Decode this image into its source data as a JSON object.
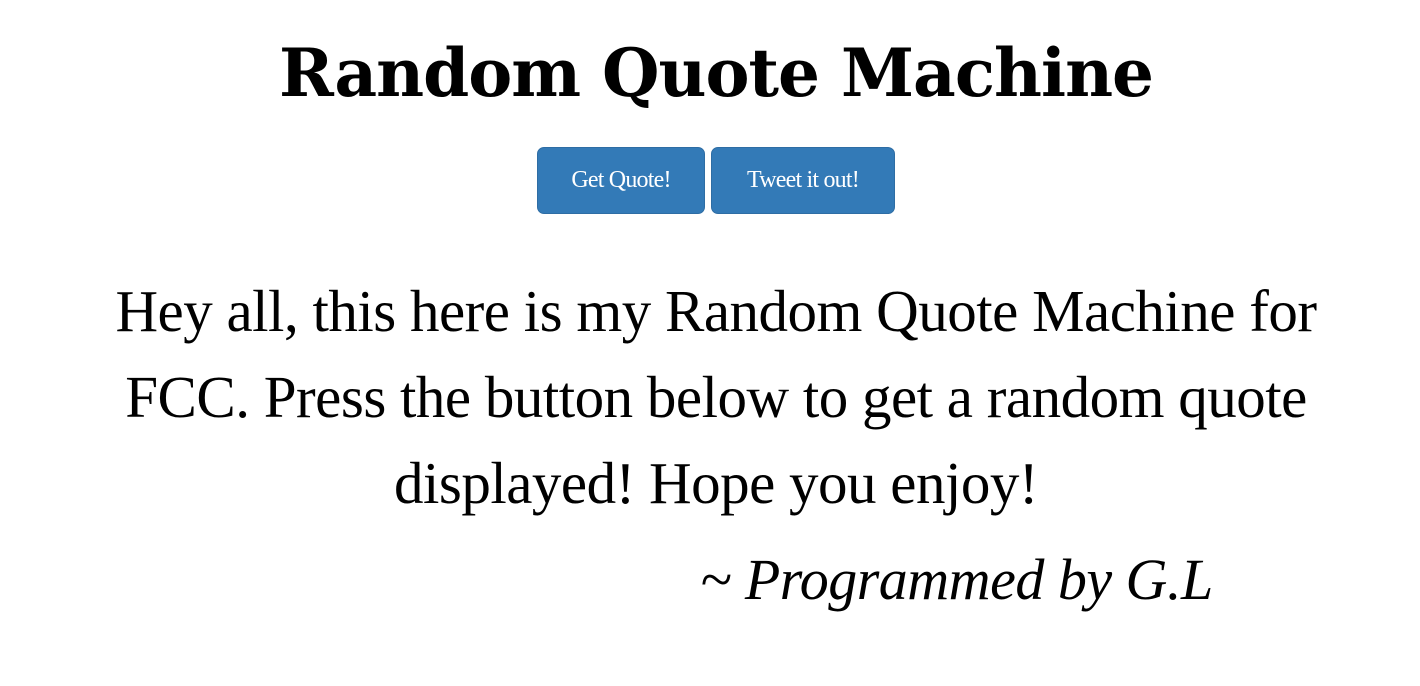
{
  "page": {
    "title": "Random Quote Machine"
  },
  "buttons": {
    "get_quote_label": "Get Quote!",
    "tweet_label": "Tweet it out!"
  },
  "quote": {
    "text": "Hey all, this here is my Random Quote Machine for FCC. Press the button below to get a random quote displayed! Hope you enjoy!",
    "author": "~ Programmed by G.L"
  },
  "colors": {
    "button_background": "#337ab7",
    "button_text": "#ffffff",
    "text": "#000000",
    "background": "#ffffff"
  }
}
